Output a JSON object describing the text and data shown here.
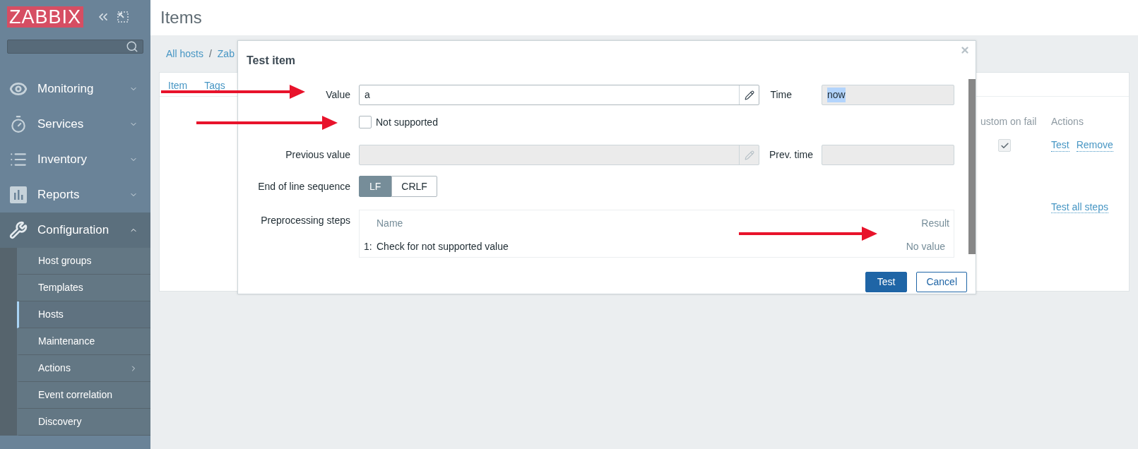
{
  "sidebar": {
    "logo": "ZABBIX",
    "menu": [
      {
        "label": "Monitoring",
        "kind": "eye",
        "expanded": false
      },
      {
        "label": "Services",
        "kind": "timer",
        "expanded": false
      },
      {
        "label": "Inventory",
        "kind": "list",
        "expanded": false
      },
      {
        "label": "Reports",
        "kind": "chart",
        "expanded": false
      },
      {
        "label": "Configuration",
        "kind": "wrench",
        "expanded": true,
        "children": [
          {
            "label": "Host groups",
            "selected": false,
            "submenu": false
          },
          {
            "label": "Templates",
            "selected": false,
            "submenu": false
          },
          {
            "label": "Hosts",
            "selected": true,
            "submenu": false
          },
          {
            "label": "Maintenance",
            "selected": false,
            "submenu": false
          },
          {
            "label": "Actions",
            "selected": false,
            "submenu": true
          },
          {
            "label": "Event correlation",
            "selected": false,
            "submenu": false
          },
          {
            "label": "Discovery",
            "selected": false,
            "submenu": false
          }
        ]
      }
    ]
  },
  "page": {
    "title": "Items",
    "breadcrumb": [
      "All hosts",
      "Zab"
    ],
    "breadcrumb_separator": "/",
    "tabs": [
      {
        "label": "Item",
        "selected": false
      },
      {
        "label": "Tags",
        "selected": false
      }
    ],
    "steps": {
      "columns": [
        "ustom on fail",
        "Actions"
      ],
      "rows": [
        {
          "custom_on_fail": true,
          "actions": [
            "Test",
            "Remove"
          ]
        }
      ],
      "test_all": "Test all steps"
    }
  },
  "dialog": {
    "title": "Test item",
    "value": {
      "label": "Value",
      "value": "a"
    },
    "time": {
      "label": "Time",
      "value": "now",
      "highlighted": true
    },
    "not_supported": {
      "label": "Not supported",
      "checked": false
    },
    "previous_value": {
      "label": "Previous value"
    },
    "prev_time": {
      "label": "Prev. time"
    },
    "eol": {
      "label": "End of line sequence",
      "options": [
        {
          "label": "LF",
          "selected": true
        },
        {
          "label": "CRLF",
          "selected": false
        }
      ]
    },
    "preprocessing": {
      "label": "Preprocessing steps",
      "columns": [
        "Name",
        "Result"
      ],
      "rows": [
        {
          "index": "1:",
          "name": "Check for not supported value",
          "result": "No value"
        }
      ]
    },
    "buttons": [
      {
        "label": "Test",
        "kind": "primary"
      },
      {
        "label": "Cancel",
        "kind": "secondary"
      }
    ]
  }
}
